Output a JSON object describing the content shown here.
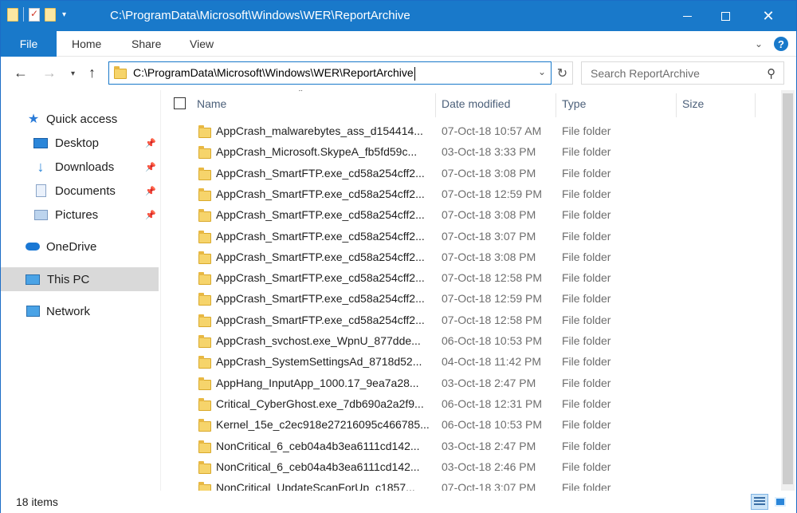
{
  "window": {
    "title": "C:\\ProgramData\\Microsoft\\Windows\\WER\\ReportArchive",
    "minimize_symbol": "—",
    "maximize_symbol": "☐",
    "close_symbol": "✕"
  },
  "ribbon": {
    "tabs": [
      {
        "label": "File"
      },
      {
        "label": "Home"
      },
      {
        "label": "Share"
      },
      {
        "label": "View"
      }
    ],
    "expand_symbol": "⌄",
    "help_label": "?"
  },
  "navigation": {
    "back_symbol": "←",
    "forward_symbol": "→",
    "recent_symbol": "⌄",
    "up_symbol": "↑",
    "address": "C:\\ProgramData\\Microsoft\\Windows\\WER\\ReportArchive",
    "address_dropdown_symbol": "⌄",
    "refresh_symbol": "↻",
    "search_placeholder": "Search ReportArchive",
    "search_icon": "⚲"
  },
  "sidebar": {
    "items": [
      {
        "label": "Quick access",
        "icon": "star-icon"
      },
      {
        "label": "Desktop",
        "icon": "desktop-icon",
        "pinned": true
      },
      {
        "label": "Downloads",
        "icon": "download-arrow-icon",
        "pinned": true
      },
      {
        "label": "Documents",
        "icon": "document-icon",
        "pinned": true
      },
      {
        "label": "Pictures",
        "icon": "pictures-icon",
        "pinned": true
      },
      {
        "label": "OneDrive",
        "icon": "cloud-icon"
      },
      {
        "label": "This PC",
        "icon": "computer-icon",
        "selected": true
      },
      {
        "label": "Network",
        "icon": "network-icon"
      }
    ],
    "pin_symbol": "📌"
  },
  "columns": {
    "name": "Name",
    "date_modified": "Date modified",
    "type": "Type",
    "size": "Size",
    "sort_symbol": "⌃"
  },
  "files": [
    {
      "name": "AppCrash_malwarebytes_ass_d154414...",
      "date": "07-Oct-18 10:57 AM",
      "type": "File folder"
    },
    {
      "name": "AppCrash_Microsoft.SkypeA_fb5fd59c...",
      "date": "03-Oct-18 3:33 PM",
      "type": "File folder"
    },
    {
      "name": "AppCrash_SmartFTP.exe_cd58a254cff2...",
      "date": "07-Oct-18 3:08 PM",
      "type": "File folder"
    },
    {
      "name": "AppCrash_SmartFTP.exe_cd58a254cff2...",
      "date": "07-Oct-18 12:59 PM",
      "type": "File folder"
    },
    {
      "name": "AppCrash_SmartFTP.exe_cd58a254cff2...",
      "date": "07-Oct-18 3:08 PM",
      "type": "File folder"
    },
    {
      "name": "AppCrash_SmartFTP.exe_cd58a254cff2...",
      "date": "07-Oct-18 3:07 PM",
      "type": "File folder"
    },
    {
      "name": "AppCrash_SmartFTP.exe_cd58a254cff2...",
      "date": "07-Oct-18 3:08 PM",
      "type": "File folder"
    },
    {
      "name": "AppCrash_SmartFTP.exe_cd58a254cff2...",
      "date": "07-Oct-18 12:58 PM",
      "type": "File folder"
    },
    {
      "name": "AppCrash_SmartFTP.exe_cd58a254cff2...",
      "date": "07-Oct-18 12:59 PM",
      "type": "File folder"
    },
    {
      "name": "AppCrash_SmartFTP.exe_cd58a254cff2...",
      "date": "07-Oct-18 12:58 PM",
      "type": "File folder"
    },
    {
      "name": "AppCrash_svchost.exe_WpnU_877dde...",
      "date": "06-Oct-18 10:53 PM",
      "type": "File folder"
    },
    {
      "name": "AppCrash_SystemSettingsAd_8718d52...",
      "date": "04-Oct-18 11:42 PM",
      "type": "File folder"
    },
    {
      "name": "AppHang_InputApp_1000.17_9ea7a28...",
      "date": "03-Oct-18 2:47 PM",
      "type": "File folder"
    },
    {
      "name": "Critical_CyberGhost.exe_7db690a2a2f9...",
      "date": "06-Oct-18 12:31 PM",
      "type": "File folder"
    },
    {
      "name": "Kernel_15e_c2ec918e27216095c466785...",
      "date": "06-Oct-18 10:53 PM",
      "type": "File folder"
    },
    {
      "name": "NonCritical_6_ceb04a4b3ea6111cd142...",
      "date": "03-Oct-18 2:47 PM",
      "type": "File folder"
    },
    {
      "name": "NonCritical_6_ceb04a4b3ea6111cd142...",
      "date": "03-Oct-18 2:46 PM",
      "type": "File folder"
    },
    {
      "name": "NonCritical_UpdateScanForUp_c1857...",
      "date": "07-Oct-18 3:07 PM",
      "type": "File folder"
    }
  ],
  "status": {
    "item_count": "18 items"
  }
}
